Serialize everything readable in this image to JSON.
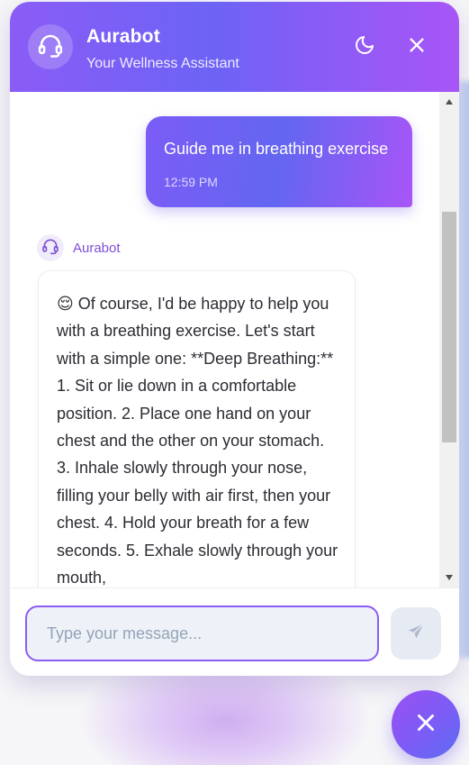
{
  "header": {
    "title": "Aurabot",
    "subtitle": "Your Wellness Assistant",
    "avatar_icon": "headset-icon",
    "theme_toggle_icon": "moon-icon",
    "close_icon": "close-icon"
  },
  "messages": [
    {
      "role": "user",
      "text": "Guide me in breathing exercise",
      "time": "12:59 PM"
    },
    {
      "role": "bot",
      "sender": "Aurabot",
      "emoji": "😌",
      "text": "Of course, I'd be happy to help you with a breathing exercise. Let's start with a simple one: **Deep Breathing:** 1. Sit or lie down in a comfortable position. 2. Place one hand on your chest and the other on your stomach. 3. Inhale slowly through your nose, filling your belly with air first, then your chest. 4. Hold your breath for a few seconds. 5. Exhale slowly through your mouth,"
    }
  ],
  "composer": {
    "placeholder": "Type your message...",
    "value": "",
    "send_icon": "send-icon"
  },
  "launcher": {
    "icon": "close-icon"
  },
  "colors": {
    "brand_start": "#8b5cf6",
    "brand_mid": "#6366f1",
    "brand_end": "#a855f7",
    "bot_name": "#7e4fd6",
    "input_border": "#8b5cf6"
  }
}
